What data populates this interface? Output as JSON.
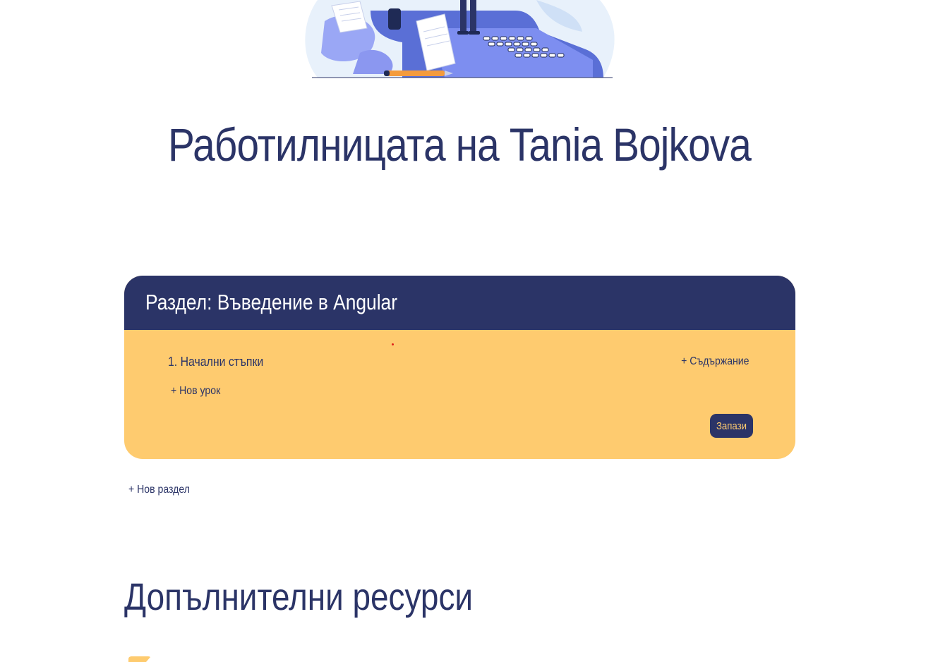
{
  "header": {
    "illustration_icon": "typewriter-illustration-icon",
    "title": "Работилницата на Tania Bojkova"
  },
  "sections": [
    {
      "title": "Раздел: Въведение в Angular",
      "lessons": [
        {
          "title": "1. Начални стъпки",
          "add_content_label": "+ Съдържание"
        }
      ],
      "add_lesson_label": "+ Нов урок",
      "save_label": "Запази"
    }
  ],
  "add_section_label": "+ Нов раздел",
  "resources": {
    "title": "Допълнителни ресурси",
    "icon": "resource-icon"
  },
  "colors": {
    "primary": "#2b3467",
    "accent": "#fecb6f",
    "illustration_blue": "#5a6fd6",
    "illustration_light": "#e8f1fb",
    "pencil_orange": "#f49b3c"
  }
}
